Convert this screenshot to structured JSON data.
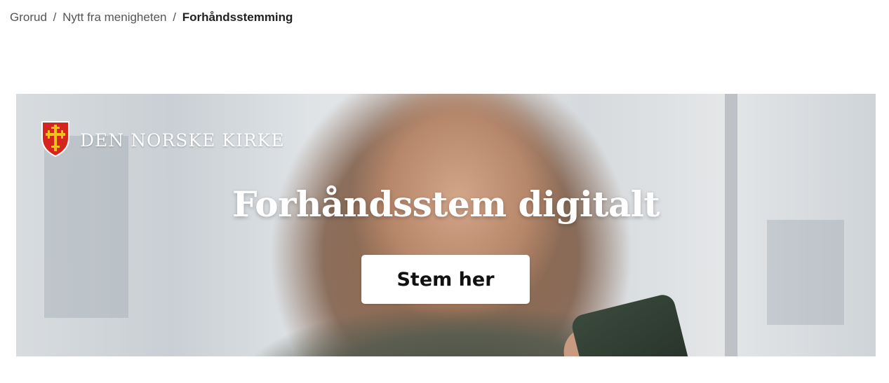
{
  "breadcrumb": {
    "items": [
      "Grorud",
      "Nytt fra menigheten"
    ],
    "separator": "/",
    "current": "Forhåndsstemming"
  },
  "banner": {
    "logo_text": "DEN NORSKE KIRKE",
    "logo_icon": "church-shield-icon",
    "headline": "Forhåndsstem digitalt",
    "button_label": "Stem her"
  },
  "colors": {
    "shield_red": "#d6241f",
    "cross_gold": "#f2c21b",
    "button_bg": "#ffffff"
  }
}
